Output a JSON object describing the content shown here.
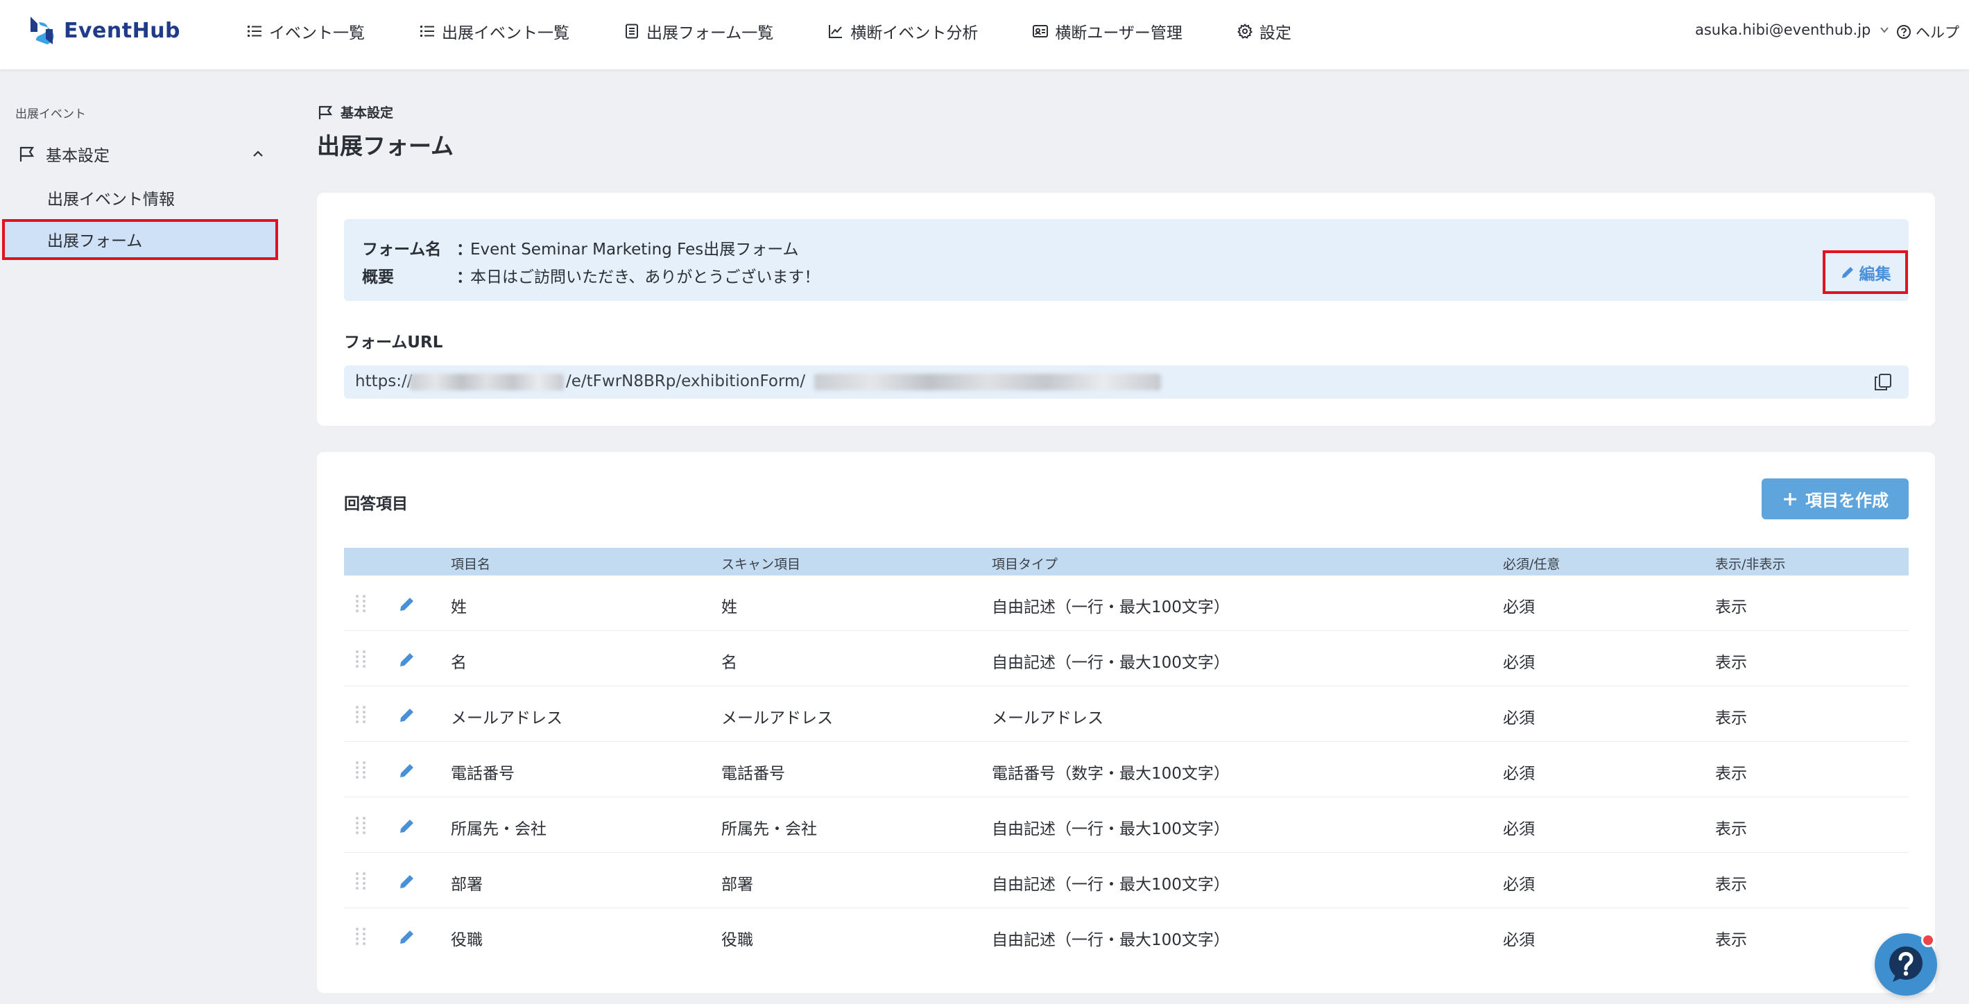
{
  "brand": {
    "name": "EventHub",
    "accent": "#1f3b8a"
  },
  "nav": [
    {
      "label": "イベント一覧",
      "icon": "list-icon"
    },
    {
      "label": "出展イベント一覧",
      "icon": "list-icon"
    },
    {
      "label": "出展フォーム一覧",
      "icon": "form-icon"
    },
    {
      "label": "横断イベント分析",
      "icon": "chart-icon"
    },
    {
      "label": "横断ユーザー管理",
      "icon": "id-card-icon"
    },
    {
      "label": "設定",
      "icon": "gear-icon"
    }
  ],
  "user": {
    "email": "asuka.hibi@eventhub.jp"
  },
  "help": {
    "label": "ヘルプ"
  },
  "sidebar": {
    "caption": "出展イベント",
    "group": "基本設定",
    "items": [
      {
        "label": "出展イベント情報"
      },
      {
        "label": "出展フォーム"
      }
    ]
  },
  "page": {
    "breadcrumb": "基本設定",
    "title": "出展フォーム"
  },
  "form_info": {
    "name_label": "フォーム名",
    "name_value": "Event Seminar Marketing Fes出展フォーム",
    "summary_label": "概要",
    "summary_value": "本日はご訪問いただき、ありがとうございます！",
    "separator": "：",
    "edit_label": "編集"
  },
  "form_url": {
    "label": "フォームURL",
    "prefix": "https://",
    "middle": "/e/tFwrN8BRp/exhibitionForm/"
  },
  "answers": {
    "title": "回答項目",
    "create_label": "項目を作成",
    "columns": [
      "項目名",
      "スキャン項目",
      "項目タイプ",
      "必須/任意",
      "表示/非表示"
    ],
    "rows": [
      {
        "name": "姓",
        "scan": "姓",
        "type": "自由記述（一行・最大100文字）",
        "required": "必須",
        "visible": "表示"
      },
      {
        "name": "名",
        "scan": "名",
        "type": "自由記述（一行・最大100文字）",
        "required": "必須",
        "visible": "表示"
      },
      {
        "name": "メールアドレス",
        "scan": "メールアドレス",
        "type": "メールアドレス",
        "required": "必須",
        "visible": "表示"
      },
      {
        "name": "電話番号",
        "scan": "電話番号",
        "type": "電話番号（数字・最大100文字）",
        "required": "必須",
        "visible": "表示"
      },
      {
        "name": "所属先・会社",
        "scan": "所属先・会社",
        "type": "自由記述（一行・最大100文字）",
        "required": "必須",
        "visible": "表示"
      },
      {
        "name": "部署",
        "scan": "部署",
        "type": "自由記述（一行・最大100文字）",
        "required": "必須",
        "visible": "表示"
      },
      {
        "name": "役職",
        "scan": "役職",
        "type": "自由記述（一行・最大100文字）",
        "required": "必須",
        "visible": "表示"
      }
    ]
  },
  "colors": {
    "highlight": "#e0141e",
    "link": "#4a90d9",
    "button": "#5ea5dd"
  }
}
